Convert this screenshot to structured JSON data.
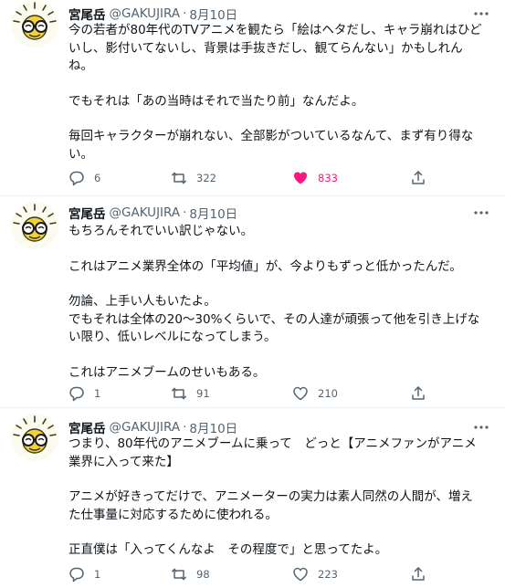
{
  "tweets": [
    {
      "author": "宮尾岳",
      "handle": "@GAKUJIRA",
      "separator": "·",
      "date": "8月10日",
      "paragraphs": [
        "今の若者が80年代のTVアニメを観たら「絵はヘタだし、キャラ崩れはひど\nいし、影付いてないし、背景は手抜きだし、観てらんない」かもしれん\nね。",
        "でもそれは「あの当時はそれで当たり前」なんだよ。",
        "毎回キャラクターが崩れない、全部影がついているなんて、まず有り得な\nい。"
      ],
      "replies": "6",
      "retweets": "322",
      "likes": "833",
      "liked": true
    },
    {
      "author": "宮尾岳",
      "handle": "@GAKUJIRA",
      "separator": "·",
      "date": "8月10日",
      "paragraphs": [
        "もちろんそれでいい訳じゃない。",
        "これはアニメ業界全体の「平均値」が、今よりもずっと低かったんだ。",
        "勿論、上手い人もいたよ。\nでもそれは全体の20〜30%くらいで、その人達が頑張って他を引き上げな\nい限り、低いレベルになってしまう。",
        "これはアニメブームのせいもある。"
      ],
      "replies": "1",
      "retweets": "91",
      "likes": "210",
      "liked": false
    },
    {
      "author": "宮尾岳",
      "handle": "@GAKUJIRA",
      "separator": "·",
      "date": "8月10日",
      "paragraphs": [
        "つまり、80年代のアニメブームに乗って　どっと【アニメファンがアニメ\n業界に入って来た】",
        "アニメが好きってだけで、アニメーターの実力は素人同然の人間が、増え\nた仕事量に対応するために使われる。",
        "正直僕は「入ってくんなよ　その程度で」と思ってたよ。"
      ],
      "replies": "1",
      "retweets": "98",
      "likes": "223",
      "liked": false
    }
  ],
  "colors": {
    "text": "#0f1419",
    "secondary": "#536471",
    "like_active": "#f91880",
    "divider": "#eff3f4"
  },
  "icons": [
    "avatar-illustration",
    "more-icon",
    "reply-icon",
    "retweet-icon",
    "heart-icon",
    "share-icon"
  ]
}
